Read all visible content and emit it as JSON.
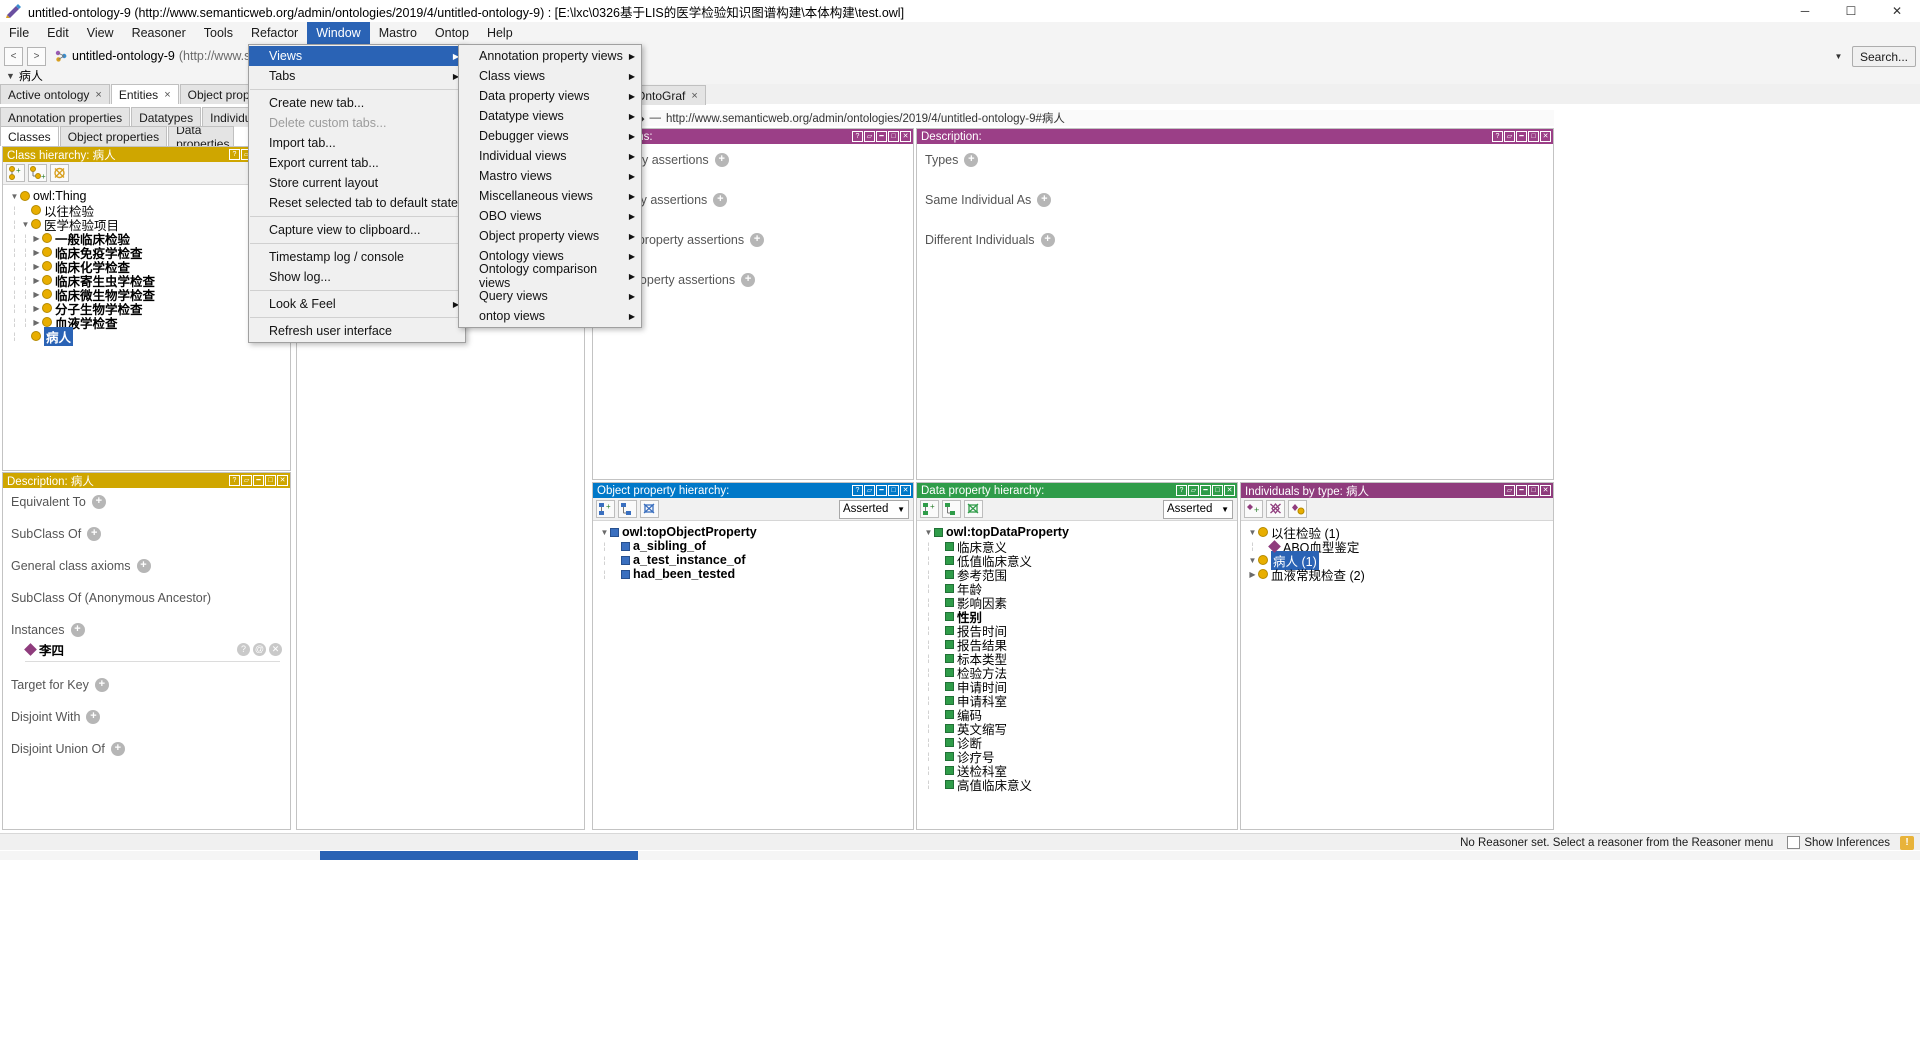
{
  "window": {
    "title": "untitled-ontology-9 (http://www.semanticweb.org/admin/ontologies/2019/4/untitled-ontology-9)  : [E:\\lxc\\0326基于LIS的医学检验知识图谱构建\\本体构建\\test.owl]",
    "minimize": "─",
    "maximize": "☐",
    "close": "✕"
  },
  "menubar": {
    "items": [
      "File",
      "Edit",
      "View",
      "Reasoner",
      "Tools",
      "Refactor",
      "Window",
      "Mastro",
      "Ontop",
      "Help"
    ],
    "active": "Window"
  },
  "iri_bar": {
    "back": "<",
    "forward": ">",
    "ontology_label": "untitled-ontology-9",
    "ontology_iri": "(http://www.semanticweb.org/admin/ontologies/2019/4/untitled-ontology-9)",
    "search_label": "Search...",
    "dropdown_arrow": "▼"
  },
  "breadcrumb": {
    "arrow": "▼",
    "text": "病人"
  },
  "tabs": [
    {
      "label": "Active ontology",
      "closable": true,
      "selected": false
    },
    {
      "label": "Entities",
      "closable": true,
      "selected": true
    },
    {
      "label": "Object properties",
      "closable": true,
      "selected": false
    },
    {
      "label": "OntoGraf",
      "closable": true,
      "selected": false
    }
  ],
  "entity_subtabs": {
    "row1": [
      "Annotation properties",
      "Datatypes",
      "Individuals"
    ],
    "row2": [
      "Classes",
      "Object properties",
      "Data properties"
    ],
    "selected": "Classes"
  },
  "window_menu": {
    "items": [
      {
        "label": "Views",
        "submenu": true,
        "highlighted": true,
        "enabled": true
      },
      {
        "label": "Tabs",
        "submenu": true,
        "highlighted": false,
        "enabled": true
      },
      {
        "separator": true
      },
      {
        "label": "Create new tab...",
        "submenu": false,
        "enabled": true
      },
      {
        "label": "Delete custom tabs...",
        "submenu": false,
        "enabled": false
      },
      {
        "label": "Import tab...",
        "submenu": false,
        "enabled": true
      },
      {
        "label": "Export current tab...",
        "submenu": false,
        "enabled": true
      },
      {
        "label": "Store current layout",
        "submenu": false,
        "enabled": true
      },
      {
        "label": "Reset selected tab to default state",
        "submenu": false,
        "enabled": true
      },
      {
        "separator": true
      },
      {
        "label": "Capture view to clipboard...",
        "submenu": false,
        "enabled": true
      },
      {
        "separator": true
      },
      {
        "label": "Timestamp log / console",
        "submenu": false,
        "enabled": true
      },
      {
        "label": "Show log...",
        "submenu": false,
        "enabled": true
      },
      {
        "separator": true
      },
      {
        "label": "Look & Feel",
        "submenu": true,
        "enabled": true
      },
      {
        "separator": true
      },
      {
        "label": "Refresh user interface",
        "submenu": false,
        "enabled": true
      }
    ]
  },
  "views_menu": {
    "items": [
      "Annotation property views",
      "Class views",
      "Data property views",
      "Datatype views",
      "Debugger views",
      "Individual views",
      "Mastro views",
      "Miscellaneous views",
      "OBO views",
      "Object property views",
      "Ontology views",
      "Ontology comparison views",
      "Query views",
      "ontop views"
    ],
    "caret": "▶"
  },
  "class_hierarchy": {
    "header": "Class hierarchy: 病人",
    "toolbar_icons": [
      "add-subclass-icon",
      "add-sibling-class-icon",
      "delete-class-icon"
    ],
    "tree": [
      {
        "label": "owl:Thing",
        "depth": 0,
        "twisty": "▼",
        "bold": false,
        "selected": false
      },
      {
        "label": "以往检验",
        "depth": 1,
        "twisty": "",
        "bold": false,
        "selected": false
      },
      {
        "label": "医学检验项目",
        "depth": 1,
        "twisty": "▼",
        "bold": false,
        "selected": false
      },
      {
        "label": "一般临床检验",
        "depth": 2,
        "twisty": "▶",
        "bold": true,
        "selected": false
      },
      {
        "label": "临床免疫学检查",
        "depth": 2,
        "twisty": "▶",
        "bold": true,
        "selected": false
      },
      {
        "label": "临床化学检查",
        "depth": 2,
        "twisty": "▶",
        "bold": true,
        "selected": false
      },
      {
        "label": "临床寄生虫学检查",
        "depth": 2,
        "twisty": "▶",
        "bold": true,
        "selected": false
      },
      {
        "label": "临床微生物学检查",
        "depth": 2,
        "twisty": "▶",
        "bold": true,
        "selected": false
      },
      {
        "label": "分子生物学检查",
        "depth": 2,
        "twisty": "▶",
        "bold": true,
        "selected": false
      },
      {
        "label": "血液学检查",
        "depth": 2,
        "twisty": "▶",
        "bold": true,
        "selected": false
      },
      {
        "label": "病人",
        "depth": 1,
        "twisty": "",
        "bold": true,
        "selected": true
      }
    ]
  },
  "class_description": {
    "header": "Description: 病人",
    "rows": [
      {
        "label": "Equivalent To",
        "plus": true
      },
      {
        "label": "SubClass Of",
        "plus": true
      },
      {
        "label": "General class axioms",
        "plus": true
      },
      {
        "label": "SubClass Of (Anonymous Ancestor)",
        "plus": false
      },
      {
        "label": "Instances",
        "plus": true
      },
      {
        "label": "Target for Key",
        "plus": true
      },
      {
        "label": "Disjoint With",
        "plus": true
      },
      {
        "label": "Disjoint Union Of",
        "plus": true
      }
    ],
    "instance": "李四",
    "instance_actions": [
      "help-icon",
      "annotate-icon",
      "delete-icon"
    ]
  },
  "individual_annotations": {
    "header": "Annotations:",
    "iri_prefix": "—",
    "iri": "http://www.semanticweb.org/admin/ontologies/2019/4/untitled-ontology-9#病人",
    "rows": [
      "Property assertions",
      "property assertions",
      "object property assertions",
      "data property assertions"
    ],
    "title_left": "assertions:"
  },
  "individual_description": {
    "header": "Description:",
    "rows": [
      {
        "label": "Types",
        "plus": true
      },
      {
        "label": "Same Individual As",
        "plus": true
      },
      {
        "label": "Different Individuals",
        "plus": true
      }
    ]
  },
  "object_property_hierarchy": {
    "header": "Object property hierarchy:",
    "mode": "Asserted",
    "tree": [
      {
        "label": "owl:topObjectProperty",
        "depth": 0,
        "twisty": "▼",
        "bold": true
      },
      {
        "label": "a_sibling_of",
        "depth": 1,
        "twisty": "",
        "bold": true
      },
      {
        "label": "a_test_instance_of",
        "depth": 1,
        "twisty": "",
        "bold": true
      },
      {
        "label": "had_been_tested",
        "depth": 1,
        "twisty": "",
        "bold": true
      }
    ]
  },
  "data_property_hierarchy": {
    "header": "Data property hierarchy:",
    "mode": "Asserted",
    "tree": [
      {
        "label": "owl:topDataProperty",
        "depth": 0,
        "twisty": "▼",
        "bold": true
      },
      {
        "label": "临床意义",
        "depth": 1,
        "twisty": "",
        "bold": false
      },
      {
        "label": "低值临床意义",
        "depth": 1,
        "twisty": "",
        "bold": false
      },
      {
        "label": "参考范围",
        "depth": 1,
        "twisty": "",
        "bold": false
      },
      {
        "label": "年龄",
        "depth": 1,
        "twisty": "",
        "bold": false
      },
      {
        "label": "影响因素",
        "depth": 1,
        "twisty": "",
        "bold": false
      },
      {
        "label": "性别",
        "depth": 1,
        "twisty": "",
        "bold": true
      },
      {
        "label": "报告时间",
        "depth": 1,
        "twisty": "",
        "bold": false
      },
      {
        "label": "报告结果",
        "depth": 1,
        "twisty": "",
        "bold": false
      },
      {
        "label": "标本类型",
        "depth": 1,
        "twisty": "",
        "bold": false
      },
      {
        "label": "检验方法",
        "depth": 1,
        "twisty": "",
        "bold": false
      },
      {
        "label": "申请时间",
        "depth": 1,
        "twisty": "",
        "bold": false
      },
      {
        "label": "申请科室",
        "depth": 1,
        "twisty": "",
        "bold": false
      },
      {
        "label": "编码",
        "depth": 1,
        "twisty": "",
        "bold": false
      },
      {
        "label": "英文缩写",
        "depth": 1,
        "twisty": "",
        "bold": false
      },
      {
        "label": "诊断",
        "depth": 1,
        "twisty": "",
        "bold": false
      },
      {
        "label": "诊疗号",
        "depth": 1,
        "twisty": "",
        "bold": false
      },
      {
        "label": "送检科室",
        "depth": 1,
        "twisty": "",
        "bold": false
      },
      {
        "label": "高值临床意义",
        "depth": 1,
        "twisty": "",
        "bold": false
      }
    ]
  },
  "individuals_by_type": {
    "header": "Individuals by type: 病人",
    "toolbar_icons": [
      "add-individual-icon",
      "delete-individual-icon",
      "reset-individual-icon"
    ],
    "tree": [
      {
        "label": "以往检验 (1)",
        "depth": 0,
        "twisty": "▼",
        "type": "class",
        "selected": false
      },
      {
        "label": "ABO血型鉴定",
        "depth": 1,
        "twisty": "",
        "type": "individual",
        "selected": false
      },
      {
        "label": "病人 (1)",
        "depth": 0,
        "twisty": "▼",
        "type": "class",
        "selected": true
      },
      {
        "label": "血液常规检查 (2)",
        "depth": 0,
        "twisty": "▶",
        "type": "class",
        "selected": false
      }
    ]
  },
  "statusbar": {
    "reasoner_text": "No Reasoner set. Select a reasoner from the Reasoner menu",
    "show_inferences": "Show Inferences",
    "warning_icon": "!"
  },
  "colors": {
    "menu_highlight": "#2a63b5",
    "class_panel": "#cfa600",
    "object_property_panel": "#0078c8",
    "data_property_panel": "#2f9c49",
    "individual_panel": "#8f3c7d"
  }
}
